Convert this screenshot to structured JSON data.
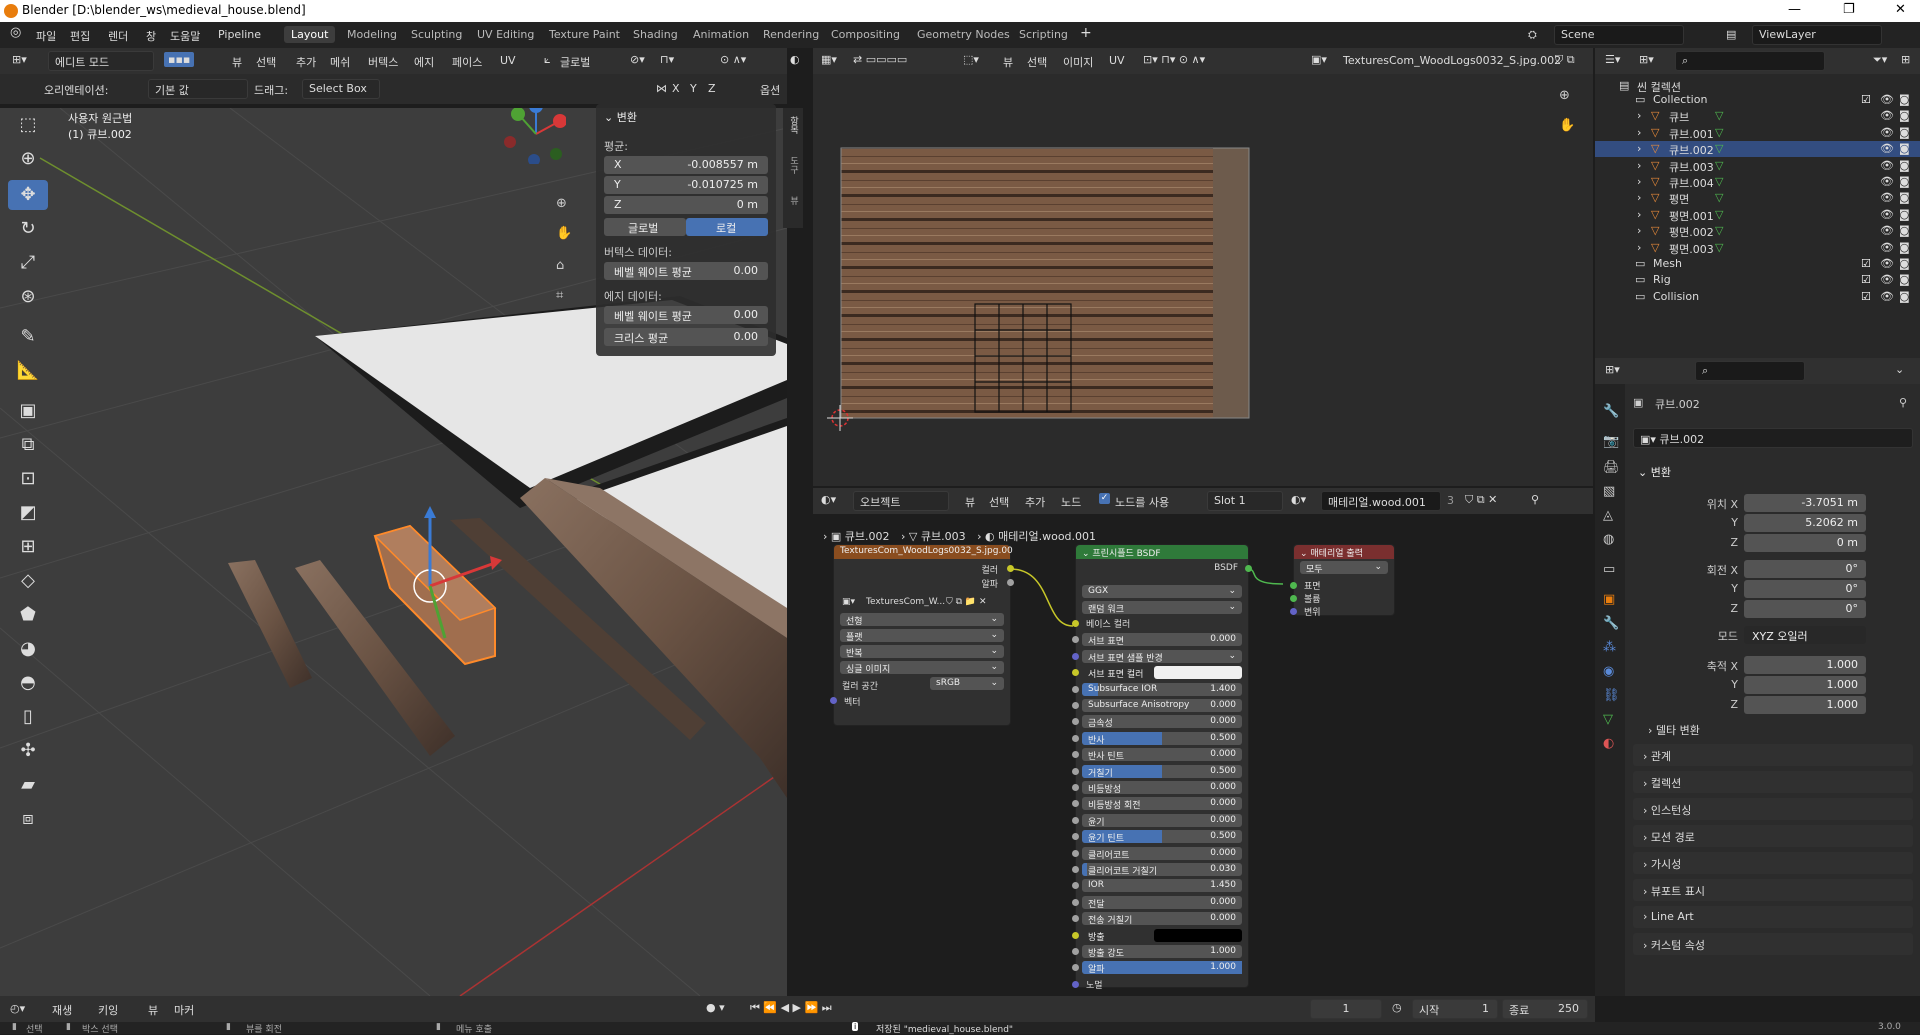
{
  "titlebar": {
    "title": "Blender [D:\\blender_ws\\medieval_house.blend]"
  },
  "menus": [
    "파일",
    "편집",
    "렌더",
    "창",
    "도움말",
    "Pipeline"
  ],
  "workspaces": [
    "Layout",
    "Modeling",
    "Sculpting",
    "UV Editing",
    "Texture Paint",
    "Shading",
    "Animation",
    "Rendering",
    "Compositing",
    "Geometry Nodes",
    "Scripting"
  ],
  "active_workspace": "Layout",
  "scene": {
    "label": "Scene",
    "viewlayer": "ViewLayer"
  },
  "viewport": {
    "mode": "에디트 모드",
    "menus": [
      "뷰",
      "선택",
      "추가",
      "메쉬",
      "버텍스",
      "에지",
      "페이스",
      "UV"
    ],
    "transform_orient": "글로벌",
    "orientation_label": "오리엔테이션:",
    "orientation_value": "기본 값",
    "drag_label": "드래그:",
    "drag_value": "Select Box",
    "axes": [
      "X",
      "Y",
      "Z"
    ],
    "options": "옵션",
    "view_title": "사용자 원근법",
    "view_object": "(1) 큐브.002"
  },
  "npanel": {
    "section": "변환",
    "median_label": "평균:",
    "x_label": "X",
    "x_value": "-0.008557 m",
    "y_label": "Y",
    "y_value": "-0.010725 m",
    "z_label": "Z",
    "z_value": "0 m",
    "global_btn": "글로벌",
    "local_btn": "로컬",
    "vertex_data_label": "버텍스 데이터:",
    "vertex_bevel_label": "베벨 웨이트 평균",
    "vertex_bevel_value": "0.00",
    "edge_data_label": "에지 데이터:",
    "edge_bevel_label": "베벨 웨이트 평균",
    "edge_bevel_value": "0.00",
    "crease_label": "크리스 평균",
    "crease_value": "0.00"
  },
  "side_tabs": [
    "항목",
    "도구",
    "뷰"
  ],
  "uv_editor": {
    "menus": [
      "뷰",
      "선택",
      "이미지",
      "UV"
    ],
    "image_name": "TexturesCom_WoodLogs0032_S.jpg.002"
  },
  "node_editor": {
    "object_dd": "오브젝트",
    "menus": [
      "뷰",
      "선택",
      "추가",
      "노드"
    ],
    "use_nodes_label": "노드를 사용",
    "slot": "Slot 1",
    "material": "매테리얼.wood.001",
    "material_users": "3",
    "breadcrumb": [
      "큐브.002",
      "큐브.003",
      "매테리얼.wood.001"
    ]
  },
  "image_node": {
    "title": "TexturesCom_WoodLogs0032_S.jpg.00",
    "out_color": "컬러",
    "out_alpha": "알파",
    "image_label": "TexturesCom_W...",
    "interp": "선형",
    "projection": "플랫",
    "extension": "반복",
    "source": "싱글 이미지",
    "colorspace_label": "컬러 공간",
    "colorspace_value": "sRGB",
    "vector": "벡터"
  },
  "bsdf_node": {
    "title": "프린시플드 BSDF",
    "output": "BSDF",
    "distribution": "GGX",
    "subsurface_method": "랜덤 워크",
    "rows": [
      {
        "label": "베이스 컬러",
        "value": "",
        "fill": 0,
        "kind": "plain",
        "sock": "#c7c729"
      },
      {
        "label": "서브 표면",
        "value": "0.000",
        "fill": 0,
        "kind": "field",
        "sock": "#a1a1a1"
      },
      {
        "label": "서브 표면 샘플 반경",
        "value": "",
        "fill": 0,
        "kind": "dd",
        "sock": "#6363c7"
      },
      {
        "label": "서브 표면 컬러",
        "value": "",
        "fill": 0,
        "kind": "color",
        "sock": "#c7c729"
      },
      {
        "label": "Subsurface IOR",
        "value": "1.400",
        "fill": 0.1,
        "kind": "field",
        "sock": "#a1a1a1"
      },
      {
        "label": "Subsurface Anisotropy",
        "value": "0.000",
        "fill": 0,
        "kind": "field",
        "sock": "#a1a1a1"
      },
      {
        "label": "금속성",
        "value": "0.000",
        "fill": 0,
        "kind": "field",
        "sock": "#a1a1a1"
      },
      {
        "label": "반사",
        "value": "0.500",
        "fill": 0.5,
        "kind": "field",
        "sock": "#a1a1a1"
      },
      {
        "label": "반사 틴트",
        "value": "0.000",
        "fill": 0,
        "kind": "field",
        "sock": "#a1a1a1"
      },
      {
        "label": "거칠기",
        "value": "0.500",
        "fill": 0.5,
        "kind": "field",
        "sock": "#a1a1a1"
      },
      {
        "label": "비등방성",
        "value": "0.000",
        "fill": 0,
        "kind": "field",
        "sock": "#a1a1a1"
      },
      {
        "label": "비등방성 회전",
        "value": "0.000",
        "fill": 0,
        "kind": "field",
        "sock": "#a1a1a1"
      },
      {
        "label": "윤기",
        "value": "0.000",
        "fill": 0,
        "kind": "field",
        "sock": "#a1a1a1"
      },
      {
        "label": "윤기 틴트",
        "value": "0.500",
        "fill": 0.5,
        "kind": "field",
        "sock": "#a1a1a1"
      },
      {
        "label": "클리어코트",
        "value": "0.000",
        "fill": 0,
        "kind": "field",
        "sock": "#a1a1a1"
      },
      {
        "label": "클리어코트 거칠기",
        "value": "0.030",
        "fill": 0.03,
        "kind": "field",
        "sock": "#a1a1a1"
      },
      {
        "label": "IOR",
        "value": "1.450",
        "fill": 0,
        "kind": "field",
        "sock": "#a1a1a1"
      },
      {
        "label": "전달",
        "value": "0.000",
        "fill": 0,
        "kind": "field",
        "sock": "#a1a1a1"
      },
      {
        "label": "전송 거칠기",
        "value": "0.000",
        "fill": 0,
        "kind": "field",
        "sock": "#a1a1a1"
      },
      {
        "label": "방출",
        "value": "",
        "fill": 0,
        "kind": "black",
        "sock": "#c7c729"
      },
      {
        "label": "방출 강도",
        "value": "1.000",
        "fill": 0,
        "kind": "field",
        "sock": "#a1a1a1"
      },
      {
        "label": "알파",
        "value": "1.000",
        "fill": 1,
        "kind": "field",
        "sock": "#a1a1a1"
      },
      {
        "label": "노멀",
        "value": "",
        "fill": 0,
        "kind": "plain",
        "sock": "#6363c7"
      }
    ]
  },
  "output_node": {
    "title": "매테리얼 출력",
    "target": "모두",
    "surface": "표면",
    "volume": "볼륨",
    "displacement": "변위"
  },
  "outliner": {
    "root": "씬 컬렉션",
    "items": [
      {
        "name": "Collection",
        "indent": 1,
        "sel": false,
        "kind": "collection"
      },
      {
        "name": "큐브",
        "indent": 2,
        "sel": false,
        "kind": "mesh"
      },
      {
        "name": "큐브.001",
        "indent": 2,
        "sel": false,
        "kind": "mesh"
      },
      {
        "name": "큐브.002",
        "indent": 2,
        "sel": true,
        "kind": "mesh"
      },
      {
        "name": "큐브.003",
        "indent": 2,
        "sel": false,
        "kind": "mesh"
      },
      {
        "name": "큐브.004",
        "indent": 2,
        "sel": false,
        "kind": "mesh"
      },
      {
        "name": "평면",
        "indent": 2,
        "sel": false,
        "kind": "mesh"
      },
      {
        "name": "평면.001",
        "indent": 2,
        "sel": false,
        "kind": "mesh"
      },
      {
        "name": "평면.002",
        "indent": 2,
        "sel": false,
        "kind": "mesh"
      },
      {
        "name": "평면.003",
        "indent": 2,
        "sel": false,
        "kind": "mesh"
      },
      {
        "name": "Mesh",
        "indent": 1,
        "sel": false,
        "kind": "collection"
      },
      {
        "name": "Rig",
        "indent": 1,
        "sel": false,
        "kind": "collection"
      },
      {
        "name": "Collision",
        "indent": 1,
        "sel": false,
        "kind": "collection"
      }
    ]
  },
  "properties": {
    "object_name": "큐브.002",
    "object_field": "큐브.002",
    "transform": "변환",
    "loc_label": "위치 X",
    "loc_x": "-3.7051 m",
    "loc_y": "5.2062 m",
    "loc_z": "0 m",
    "rot_label": "회전 X",
    "rot_x": "0°",
    "rot_y": "0°",
    "rot_z": "0°",
    "mode_label": "모드",
    "mode_value": "XYZ 오일러",
    "scale_label": "축적 X",
    "scale_x": "1.000",
    "scale_y": "1.000",
    "scale_z": "1.000",
    "y": "Y",
    "z": "Z",
    "delta": "델타 변환",
    "sections": [
      "관계",
      "컬렉션",
      "인스턴싱",
      "모션 경로",
      "가시성",
      "뷰포트 표시",
      "Line Art",
      "커스텀 속성"
    ]
  },
  "timeline": {
    "menus": [
      "재생",
      "키잉",
      "뷰",
      "마커"
    ],
    "current": "1",
    "start_label": "시작",
    "start": "1",
    "end_label": "종료",
    "end": "250"
  },
  "status": {
    "select": "선택",
    "box_select": "박스 선택",
    "rotate_view": "뷰를 회전",
    "call_menu": "메뉴 호출",
    "saved": "저장된 \"medieval_house.blend\"",
    "version": "3.0.0"
  }
}
